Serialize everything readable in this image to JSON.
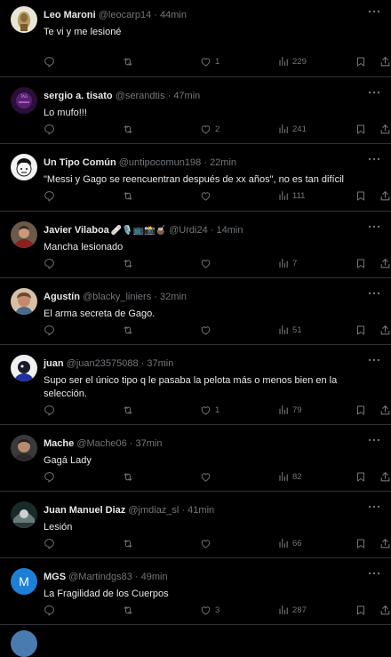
{
  "tweets": [
    {
      "name": "Leo Maroni",
      "handle": "@leocarp14",
      "time": "44min",
      "text": "Te vi y me lesioné",
      "reply": "",
      "retweet": "",
      "like": "1",
      "views": "229",
      "avatar": "avatar-leo"
    },
    {
      "name": "sergio a. tisato",
      "handle": "@serandtis",
      "time": "47min",
      "text": "Lo mufo!!!",
      "reply": "",
      "retweet": "",
      "like": "2",
      "views": "241",
      "avatar": "avatar-sergio"
    },
    {
      "name": "Un Tipo Común",
      "handle": "@untipocomun198",
      "time": "22min",
      "text": "\"Messi y Gago se reencuentran después de xx años\", no es tan difícil",
      "reply": "",
      "retweet": "",
      "like": "",
      "views": "111",
      "avatar": "avatar-untipo"
    },
    {
      "name": "Javier Vilaboa",
      "emoji": "🩹🎙️📺📸🧉",
      "handle": "@Urdi24",
      "time": "14min",
      "text": "Mancha lesionado",
      "reply": "",
      "retweet": "",
      "like": "",
      "views": "7",
      "avatar": "avatar-javier"
    },
    {
      "name": "Agustín",
      "handle": "@blacky_liniers",
      "time": "32min",
      "text": "El arma secreta de Gago.",
      "reply": "",
      "retweet": "",
      "like": "",
      "views": "51",
      "avatar": "avatar-agustin"
    },
    {
      "name": "juan",
      "handle": "@juan23575088",
      "time": "37min",
      "text": "Supo ser el único tipo q le pasaba la pelota más o menos bien en la selección.",
      "reply": "",
      "retweet": "",
      "like": "1",
      "views": "79",
      "avatar": "avatar-juan"
    },
    {
      "name": "Mache",
      "handle": "@Mache06",
      "time": "37min",
      "text": "Gagá Lady",
      "reply": "",
      "retweet": "",
      "like": "",
      "views": "82",
      "avatar": "avatar-mache"
    },
    {
      "name": "Juan Manuel Diaz",
      "handle": "@jmdiaz_sl",
      "time": "41min",
      "text": "Lesión",
      "reply": "",
      "retweet": "",
      "like": "",
      "views": "66",
      "avatar": "avatar-jmdiaz"
    },
    {
      "name": "MGS",
      "handle": "@Martindgs83",
      "time": "49min",
      "text": "La Fragilidad de los Cuerpos",
      "reply": "",
      "retweet": "",
      "like": "3",
      "views": "287",
      "avatar": "avatar-mgs",
      "avatar_letter": "M"
    }
  ],
  "separator": "·",
  "colors": {
    "background": "#000000",
    "text": "#e7e9ea",
    "muted": "#71767b",
    "border": "#2f3336"
  }
}
